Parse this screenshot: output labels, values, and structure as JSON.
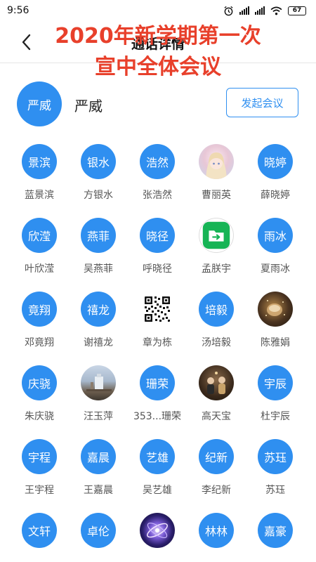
{
  "status": {
    "time": "9:56",
    "battery": "67"
  },
  "nav": {
    "title": "通话详情"
  },
  "overlay": {
    "line1": "2020年新学期第一次",
    "line2": "宣中全体会议"
  },
  "host": {
    "avatar_text": "严威",
    "name": "严威",
    "start_button": "发起会议"
  },
  "members": [
    {
      "avatar_text": "景滨",
      "name": "蓝景滨"
    },
    {
      "avatar_text": "银水",
      "name": "方银水"
    },
    {
      "avatar_text": "浩然",
      "name": "张浩然"
    },
    {
      "avatar_text": "",
      "name": "曹丽英"
    },
    {
      "avatar_text": "晓婷",
      "name": "薛晓婷"
    },
    {
      "avatar_text": "欣滢",
      "name": "叶欣滢"
    },
    {
      "avatar_text": "燕菲",
      "name": "吴燕菲"
    },
    {
      "avatar_text": "晓径",
      "name": "呼晓径"
    },
    {
      "avatar_text": "",
      "name": "孟朕宇"
    },
    {
      "avatar_text": "雨冰",
      "name": "夏雨冰"
    },
    {
      "avatar_text": "竟翔",
      "name": "邓竟翔"
    },
    {
      "avatar_text": "禧龙",
      "name": "谢禧龙"
    },
    {
      "avatar_text": "",
      "name": "章为栋"
    },
    {
      "avatar_text": "培毅",
      "name": "汤培毅"
    },
    {
      "avatar_text": "",
      "name": "陈雅娟"
    },
    {
      "avatar_text": "庆骁",
      "name": "朱庆骁"
    },
    {
      "avatar_text": "",
      "name": "汪玉萍"
    },
    {
      "avatar_text": "珊荣",
      "name": "353...珊荣"
    },
    {
      "avatar_text": "",
      "name": "高天宝"
    },
    {
      "avatar_text": "宇辰",
      "name": "杜宇辰"
    },
    {
      "avatar_text": "宇程",
      "name": "王宇程"
    },
    {
      "avatar_text": "嘉晨",
      "name": "王嘉晨"
    },
    {
      "avatar_text": "艺雄",
      "name": "吴艺雄"
    },
    {
      "avatar_text": "纪新",
      "name": "李纪新"
    },
    {
      "avatar_text": "苏珏",
      "name": "苏珏"
    },
    {
      "avatar_text": "文轩",
      "name": ""
    },
    {
      "avatar_text": "卓伦",
      "name": ""
    },
    {
      "avatar_text": "",
      "name": ""
    },
    {
      "avatar_text": "林林",
      "name": ""
    },
    {
      "avatar_text": "嘉豪",
      "name": ""
    }
  ]
}
